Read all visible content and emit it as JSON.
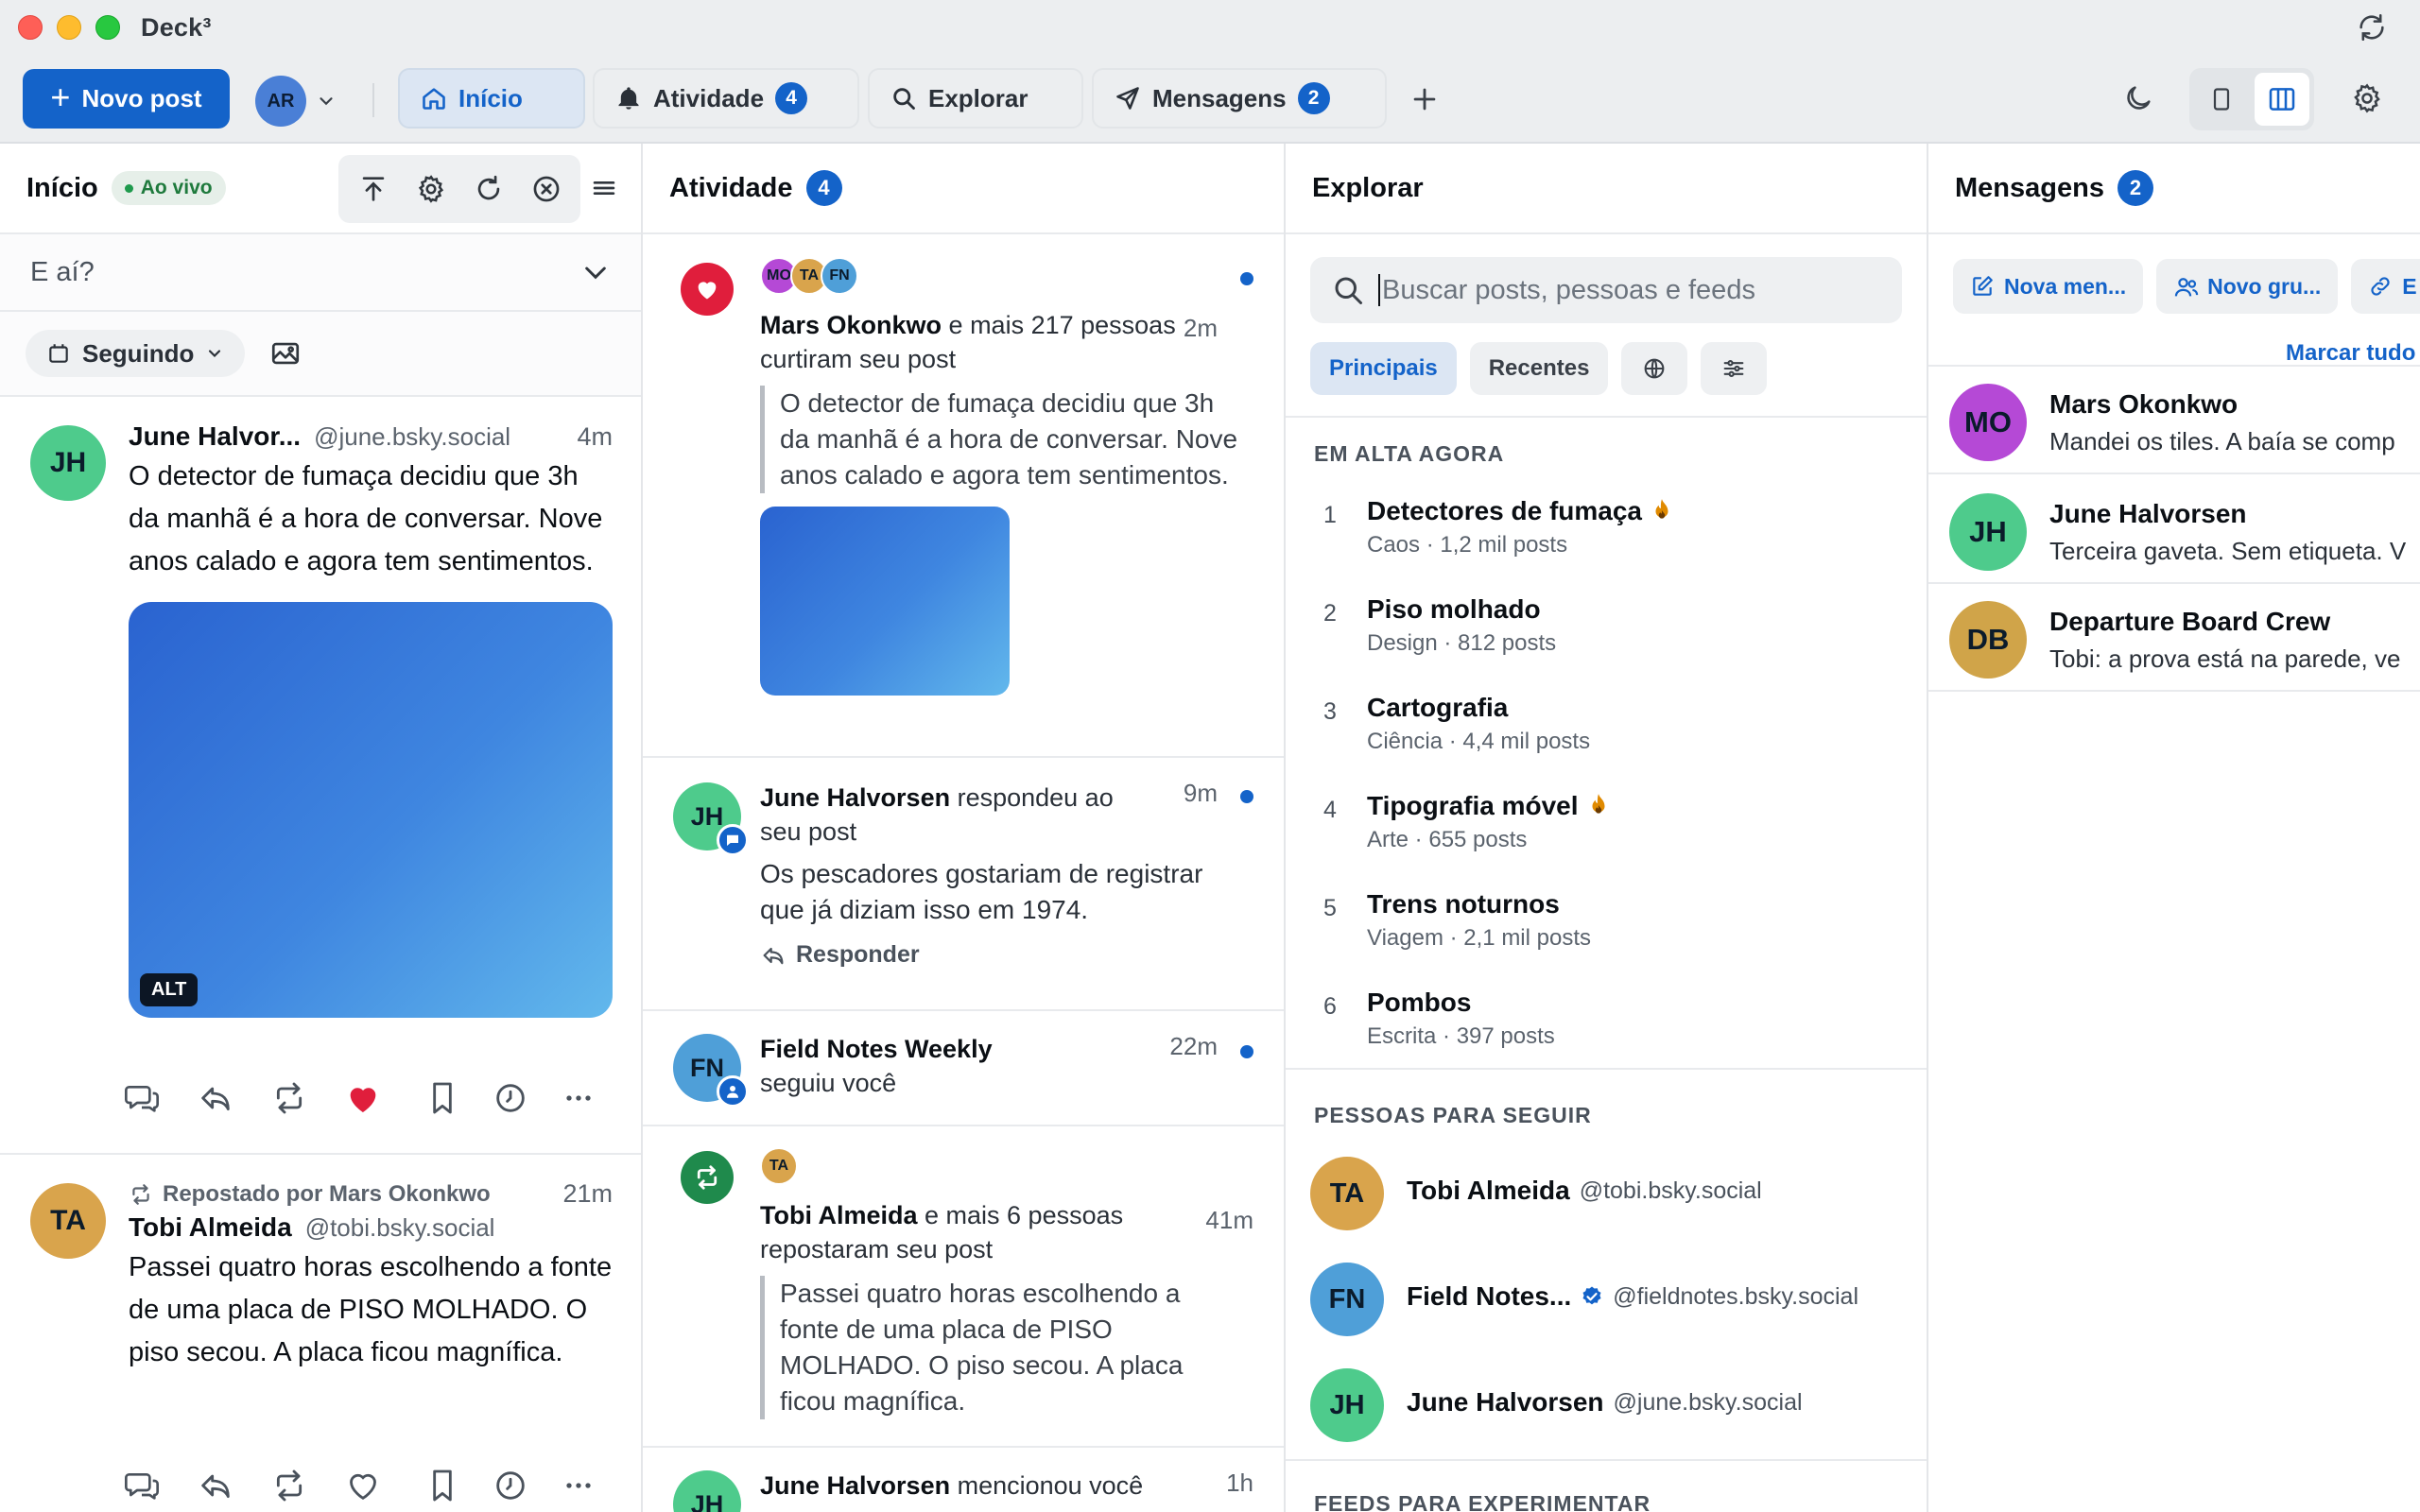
{
  "window": {
    "title": "Deck³"
  },
  "toolbar": {
    "new_post": "Novo post",
    "account_initials": "AR",
    "tabs": [
      {
        "label": "Início"
      },
      {
        "label": "Atividade",
        "badge": "4"
      },
      {
        "label": "Explorar"
      },
      {
        "label": "Mensagens",
        "badge": "2"
      }
    ]
  },
  "home": {
    "title": "Início",
    "live": "Ao vivo",
    "compose_placeholder": "E aí?",
    "filter": "Seguindo",
    "posts": [
      {
        "initials": "JH",
        "name": "June Halvor...",
        "handle": "@june.bsky.social",
        "time": "4m",
        "text": "O detector de fumaça decidiu que 3h da manhã é a hora de conversar. Nove anos calado e agora tem sentimentos.",
        "alt": "ALT"
      },
      {
        "repost_by": "Repostado por Mars Okonkwo",
        "initials": "TA",
        "name": "Tobi Almeida",
        "handle": "@tobi.bsky.social",
        "time": "21m",
        "text": "Passei quatro horas escolhendo a fonte de uma placa de PISO MOLHADO. O piso secou. A placa ficou magnífica."
      }
    ]
  },
  "activity": {
    "title": "Atividade",
    "badge": "4",
    "items": [
      {
        "avatars": [
          "MO",
          "TA",
          "FN"
        ],
        "name": "Mars Okonkwo",
        "rest": " e mais 217 pessoas curtiram seu post",
        "time": "2m",
        "quote": "O detector de fumaça decidiu que 3h da manhã é a hora de conversar. Nove anos calado e agora tem sentimentos."
      },
      {
        "initials": "JH",
        "name": "June Halvorsen",
        "rest": " respondeu ao seu post",
        "time": "9m",
        "text": "Os pescadores gostariam de registrar que já diziam isso em 1974.",
        "reply": "Responder"
      },
      {
        "initials": "FN",
        "name": "Field Notes Weekly",
        "rest": "seguiu você",
        "time": "22m"
      },
      {
        "avatars": [
          "TA"
        ],
        "name": "Tobi Almeida",
        "rest": " e mais 6 pessoas repostaram seu post",
        "time": "41m",
        "quote": "Passei quatro horas escolhendo a fonte de uma placa de PISO MOLHADO. O piso secou. A placa ficou magnífica."
      },
      {
        "initials": "JH",
        "name": "June Halvorsen",
        "rest": " mencionou você",
        "time": "1h"
      }
    ]
  },
  "explore": {
    "title": "Explorar",
    "search_placeholder": "Buscar posts, pessoas e feeds",
    "seg_top": "Principais",
    "seg_recent": "Recentes",
    "trending_label": "EM ALTA AGORA",
    "trends": [
      {
        "n": "1",
        "title": "Detectores de fumaça",
        "cat": "Caos",
        "count": "1,2 mil posts",
        "hot": true
      },
      {
        "n": "2",
        "title": "Piso molhado",
        "cat": "Design",
        "count": "812 posts",
        "hot": false
      },
      {
        "n": "3",
        "title": "Cartografia",
        "cat": "Ciência",
        "count": "4,4 mil posts",
        "hot": false
      },
      {
        "n": "4",
        "title": "Tipografia móvel",
        "cat": "Arte",
        "count": "655 posts",
        "hot": true
      },
      {
        "n": "5",
        "title": "Trens noturnos",
        "cat": "Viagem",
        "count": "2,1 mil posts",
        "hot": false
      },
      {
        "n": "6",
        "title": "Pombos",
        "cat": "Escrita",
        "count": "397 posts",
        "hot": false
      }
    ],
    "people_label": "PESSOAS PARA SEGUIR",
    "people": [
      {
        "initials": "TA",
        "name": "Tobi Almeida",
        "handle": "@tobi.bsky.social",
        "verified": false
      },
      {
        "initials": "FN",
        "name": "Field Notes...",
        "handle": "@fieldnotes.bsky.social",
        "verified": true
      },
      {
        "initials": "JH",
        "name": "June Halvorsen",
        "handle": "@june.bsky.social",
        "verified": false
      }
    ],
    "feeds_label": "FEEDS PARA EXPERIMENTAR"
  },
  "messages": {
    "title": "Mensagens",
    "badge": "2",
    "new_message": "Nova men...",
    "new_group": "Novo gru...",
    "third_button": "E",
    "mark_all": "Marcar tudo",
    "conversations": [
      {
        "initials": "MO",
        "name": "Mars Okonkwo",
        "preview": "Mandei os tiles. A baía se comp"
      },
      {
        "initials": "JH",
        "name": "June Halvorsen",
        "preview": "Terceira gaveta. Sem etiqueta. V"
      },
      {
        "initials": "DB",
        "name": "Departure Board Crew",
        "preview": "Tobi: a prova está na parede, ve"
      }
    ]
  },
  "colors": {
    "accent": "#1463c9",
    "like": "#e01e3c",
    "repost": "#1f8a4c",
    "avatar_jh": "#4ecb8c",
    "avatar_ta": "#d9a44c",
    "avatar_mo": "#b549d6",
    "avatar_fn": "#4f9fd8",
    "avatar_db": "#d0a449"
  }
}
